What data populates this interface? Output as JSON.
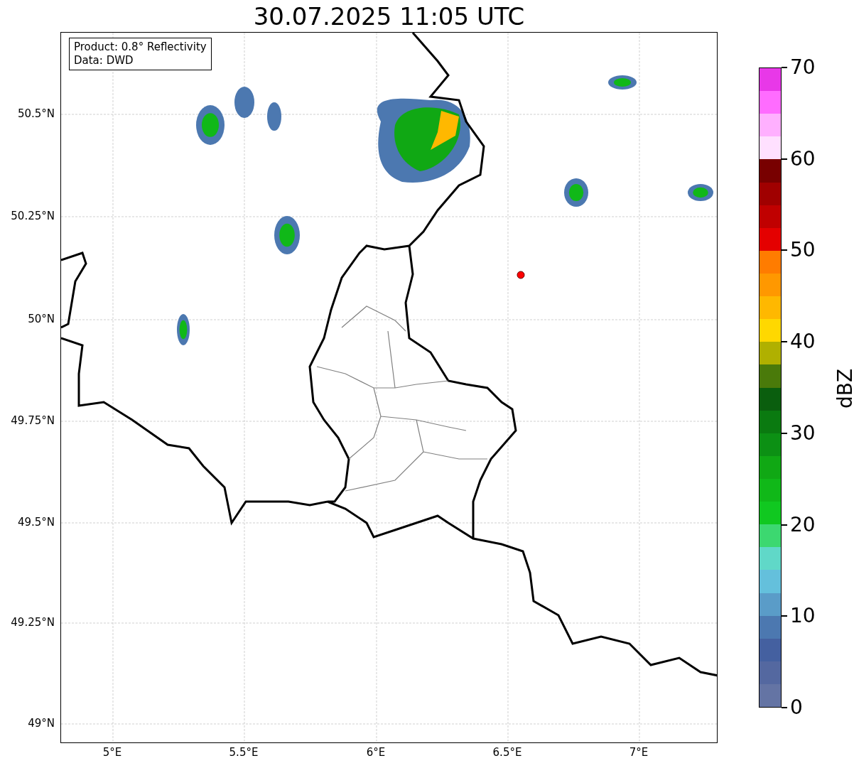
{
  "title": "30.07.2025 11:05 UTC",
  "info_box": [
    "Product: 0.8° Reflectivity",
    "Data: DWD"
  ],
  "x_axis": {
    "ticks": [
      "5°E",
      "5.5°E",
      "6°E",
      "6.5°E",
      "7°E"
    ]
  },
  "y_axis": {
    "ticks": [
      "50.5°N",
      "50.25°N",
      "50°N",
      "49.75°N",
      "49.5°N",
      "49.25°N",
      "49°N"
    ]
  },
  "colorbar": {
    "label": "dBZ",
    "ticks": [
      "70",
      "60",
      "50",
      "40",
      "30",
      "20",
      "10",
      "0"
    ],
    "segments": [
      {
        "color": "#e838e8"
      },
      {
        "color": "#ff6cff"
      },
      {
        "color": "#ffb0ff"
      },
      {
        "color": "#ffe0ff"
      },
      {
        "color": "#780000"
      },
      {
        "color": "#a00000"
      },
      {
        "color": "#c00000"
      },
      {
        "color": "#e40000"
      },
      {
        "color": "#ff7c00"
      },
      {
        "color": "#ff9800"
      },
      {
        "color": "#ffb800"
      },
      {
        "color": "#ffd800"
      },
      {
        "color": "#b0b000"
      },
      {
        "color": "#4a7a0a"
      },
      {
        "color": "#0a5e0e"
      },
      {
        "color": "#0a7a10"
      },
      {
        "color": "#0c9014"
      },
      {
        "color": "#10a814"
      },
      {
        "color": "#10b818"
      },
      {
        "color": "#10c820"
      },
      {
        "color": "#3cd870"
      },
      {
        "color": "#60d8c8"
      },
      {
        "color": "#64c0dc"
      },
      {
        "color": "#5a9cc8"
      },
      {
        "color": "#4c78b0"
      },
      {
        "color": "#4460a0"
      },
      {
        "color": "#5468a0"
      },
      {
        "color": "#6474a4"
      }
    ]
  }
}
